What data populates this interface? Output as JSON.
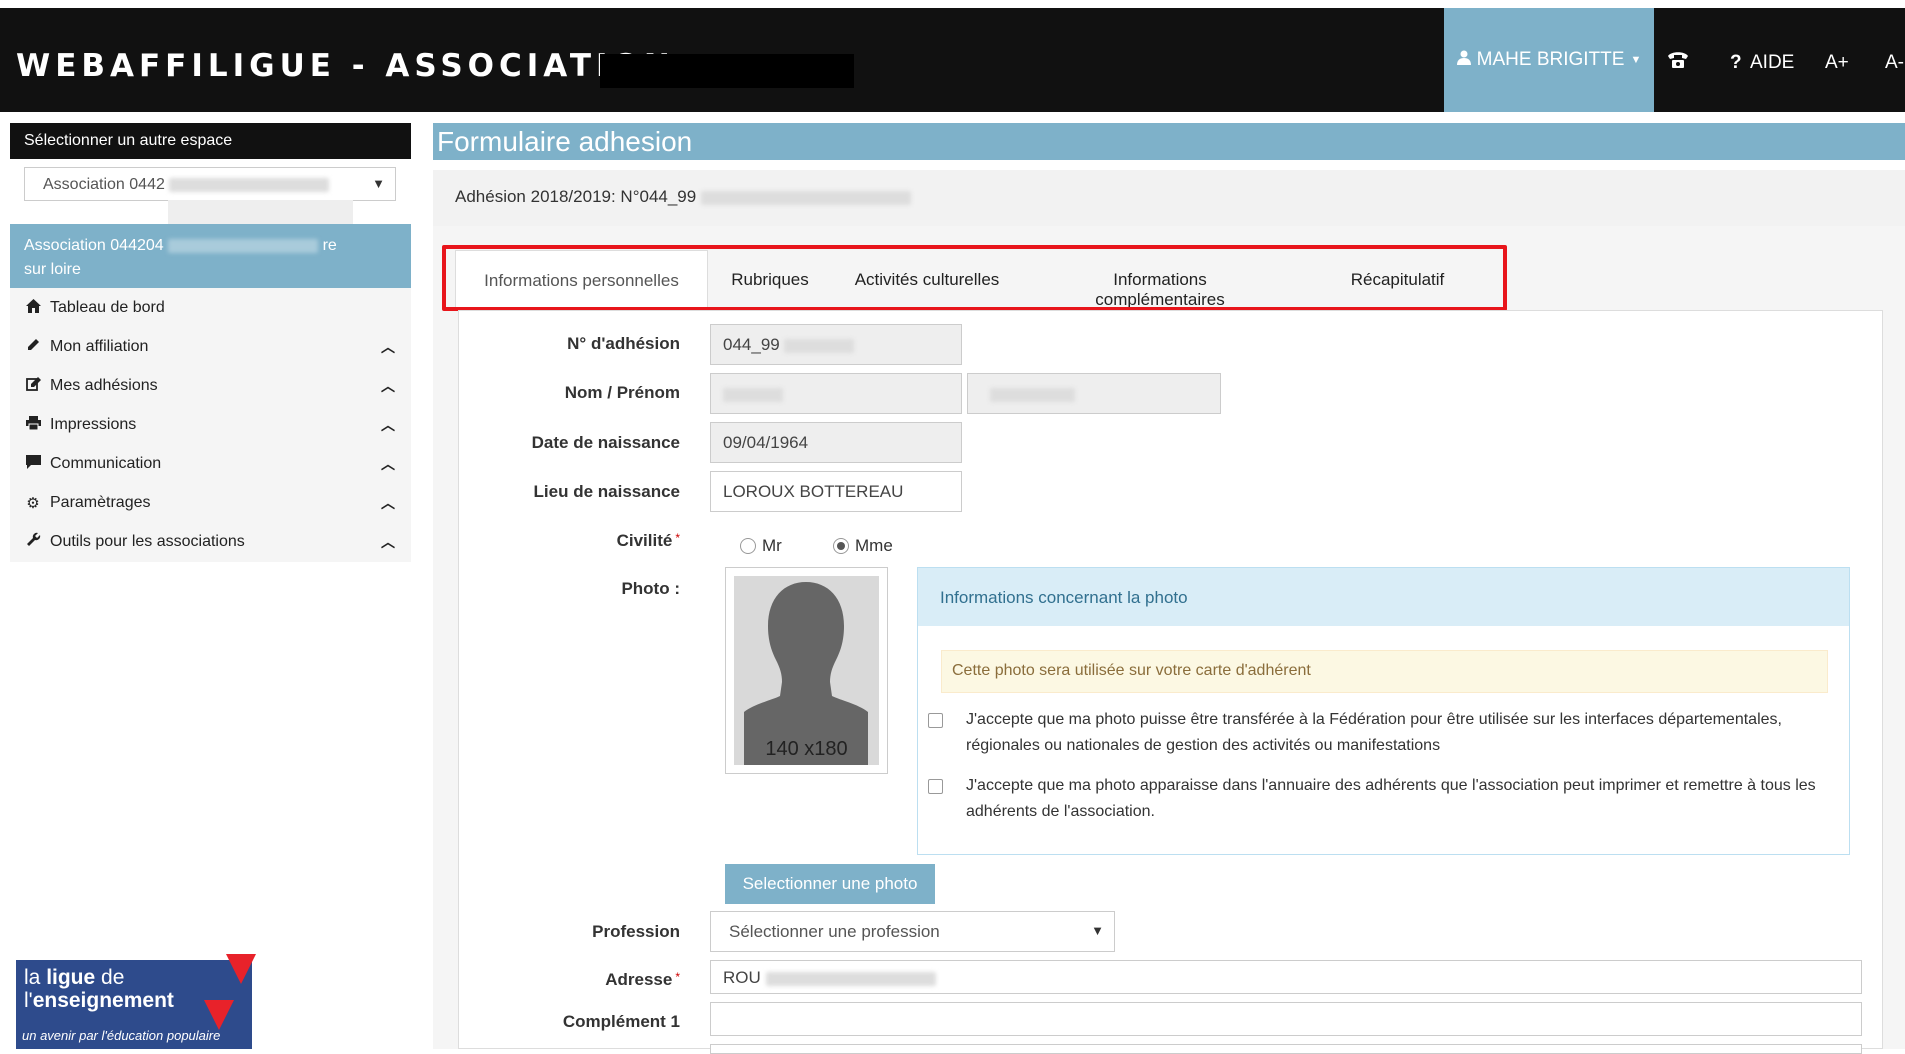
{
  "header": {
    "brand": "WEBAFFILIGUE - ASSOCIATION",
    "user_label": "MAHE BRIGITTE",
    "phone_icon": "phone-icon",
    "help_label": "AIDE",
    "font_increase": "A+",
    "font_decrease": "A-"
  },
  "sidebar": {
    "select_space_title": "Sélectionner un autre espace",
    "space_select_value": "Association 0442",
    "association_name_line1": "Association 044204",
    "association_name_suffix": "re",
    "association_name_line2": "sur loire",
    "items": [
      {
        "label": "Tableau de bord",
        "icon": "home-icon",
        "expandable": false
      },
      {
        "label": "Mon affiliation",
        "icon": "pencil-icon",
        "expandable": true
      },
      {
        "label": "Mes adhésions",
        "icon": "edit-icon",
        "expandable": true
      },
      {
        "label": "Impressions",
        "icon": "print-icon",
        "expandable": true
      },
      {
        "label": "Communication",
        "icon": "comment-icon",
        "expandable": true
      },
      {
        "label": "Paramètrages",
        "icon": "gear-icon",
        "expandable": true
      },
      {
        "label": "Outils pour les associations",
        "icon": "wrench-icon",
        "expandable": true
      }
    ],
    "logo": {
      "line1a": "la ",
      "line1b": "ligue",
      "line1c": " de",
      "line2a": "l'",
      "line2b": "enseignement",
      "tagline": "un avenir par l'éducation populaire"
    }
  },
  "main": {
    "title": "Formulaire adhesion",
    "adhesion_prefix": "Adhésion 2018/2019: N°044_99",
    "tabs": [
      {
        "label": "Informations personnelles",
        "active": true
      },
      {
        "label": "Rubriques",
        "active": false
      },
      {
        "label": "Activités culturelles",
        "active": false
      },
      {
        "label": "Informations complémentaires",
        "active": false
      },
      {
        "label": "Récapitulatif",
        "active": false
      }
    ],
    "form": {
      "adhesion_number_label": "N° d'adhésion",
      "adhesion_number_value": "044_99",
      "name_label": "Nom / Prénom",
      "birthdate_label": "Date de naissance",
      "birthdate_value": "09/04/1964",
      "birthplace_label": "Lieu de naissance",
      "birthplace_value": "LOROUX BOTTEREAU",
      "civility_label": "Civilité",
      "civility_options": [
        "Mr",
        "Mme"
      ],
      "civility_selected": "Mme",
      "photo_label": "Photo :",
      "photo_placeholder": "140 x180",
      "photo_info_title": "Informations concernant la photo",
      "photo_warning": "Cette photo sera utilisée sur votre carte d'adhérent",
      "consent_federation": "J'accepte que ma photo puisse être transférée à la Fédération pour être utilisée sur les interfaces départementales, régionales ou nationales de gestion des activités ou manifestations",
      "consent_directory": "J'accepte que ma photo apparaisse dans l'annuaire des adhérents que l'association peut imprimer et remettre à tous les adhérents de l'association.",
      "select_photo_button": "Selectionner une photo",
      "profession_label": "Profession",
      "profession_placeholder": "Sélectionner une profession",
      "address_label": "Adresse",
      "address_value": "ROU",
      "complement_label": "Complément 1",
      "required_marker": "*"
    }
  },
  "colors": {
    "accent": "#7eb1c9",
    "topbar": "#111111",
    "highlight": "#e8151b"
  }
}
